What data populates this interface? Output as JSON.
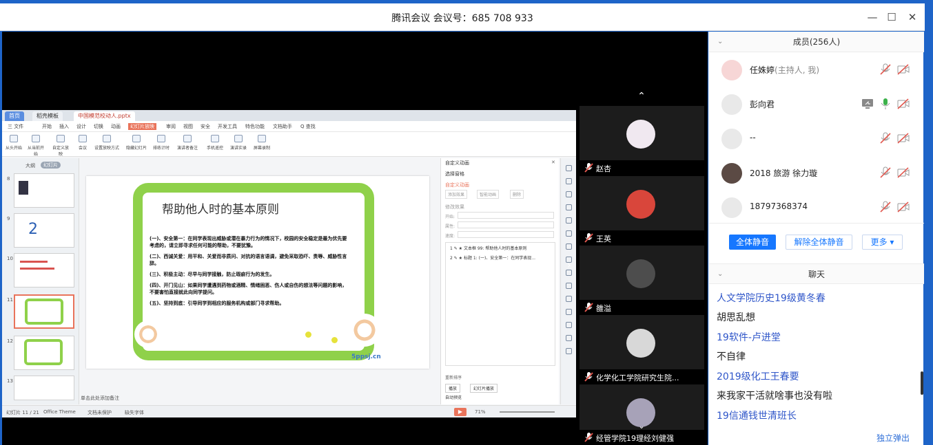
{
  "window": {
    "title": "腾讯会议  会议号：685 708 933"
  },
  "ppt": {
    "tabs": [
      "首页",
      "稻壳模板",
      "中国模范校动人.pptx"
    ],
    "menu": [
      "三 文件",
      "开始",
      "插入",
      "设计",
      "切换",
      "动画",
      "幻灯片放映",
      "审阅",
      "视图",
      "安全",
      "开发工具",
      "特色功能",
      "文档助手",
      "Q 查找"
    ],
    "tools": [
      "从头开始",
      "从当前开始",
      "自定义放映",
      "会议",
      "设置放映方式",
      "隐藏幻灯片",
      "排练计时",
      "演讲者备注",
      "手机遥控",
      "演讲实录",
      "屏幕录制"
    ],
    "thumb_tabs": [
      "大纲",
      "幻灯片"
    ],
    "thumb_numbers": [
      "8",
      "9",
      "10",
      "11",
      "12",
      "13"
    ],
    "slide": {
      "title": "帮助他人时的基本原则",
      "points": [
        "(一)、安全第一：在同学表现出威胁或潜在暴力行为的情况下，校园的安全稳定是最为优先要考虑的，请立即寻求任何可能的帮助，不要犹豫。",
        "(二)、西诚关爱：用平和、关爱而非质问、对抗的语言语调，避免采取恐吓、责辱、威胁性言辞。",
        "(三)、积极主动：尽早与同学接触，防止瑕疵行为的发生。",
        "(四)、开门见山：如果同学遭遇到药物或酒精、情绪困恶、伤人或自伤的想法等问题的影响，不要害怕直接就此向同学提问。",
        "(五)、坚持到底：引导同学到相应的服务机构或部门寻求帮助。"
      ],
      "watermark": "5ppsj.cn"
    },
    "right_panel": {
      "title": "自定义动画",
      "select_window": "选择窗格",
      "custom_anim": "自定义动画",
      "add_effect": "添加效果",
      "smart_anim": "智能动画",
      "delete": "删除",
      "modify": "修改效果",
      "start": "开始:",
      "property": "属性:",
      "speed": "速度:",
      "item1": "1 ✎ ★ 文本框 99: 帮助他人时的基本原则",
      "item2": "2 ✎ ★ 标题 1: (一)、安全第一：在同学表现...",
      "reorder": "重新排序",
      "play": "播放",
      "slideshow": "幻灯片播放",
      "autopreview": "自动预览"
    },
    "notes": "单击此处添加备注",
    "status": {
      "slide_of": "幻灯片 11 / 21",
      "theme": "Office Theme",
      "backup": "文档未保护",
      "font": "缺失字体",
      "zoom": "71%"
    }
  },
  "video_tiles": [
    {
      "name": "赵杏"
    },
    {
      "name": "王英"
    },
    {
      "name": "雒溢"
    },
    {
      "name": "化学化工学院研究生院..."
    },
    {
      "name": "经管学院19理经刘健强"
    }
  ],
  "members": {
    "header": "成员(256人)",
    "list": [
      {
        "name": "任姝婷",
        "role": "(主持人, 我)"
      },
      {
        "name": "彭向君",
        "role": ""
      },
      {
        "name": "--",
        "role": ""
      },
      {
        "name": " 2018 旅游 徐力璇",
        "role": ""
      },
      {
        "name": "18797368374",
        "role": ""
      }
    ],
    "mute_all": "全体静音",
    "unmute_all": "解除全体静音",
    "more": "更多 ▾"
  },
  "chat": {
    "header": "聊天",
    "messages": [
      {
        "sender": "人文学院历史19级黄冬春",
        "text": "胡思乱想"
      },
      {
        "sender": "19软件-卢进堂",
        "text": "不自律"
      },
      {
        "sender": "2019级化工王春要",
        "text": "来我家干活就啥事也没有啦"
      },
      {
        "sender": "19信通钱世清班长",
        "text": ""
      }
    ],
    "popout": "独立弹出"
  },
  "colors": {
    "accent": "#1e64c8",
    "primary_button": "#1677ff",
    "chat_sender": "#2f56c9",
    "slide_green": "#8fd14a",
    "muted_red": "#e2584f"
  }
}
